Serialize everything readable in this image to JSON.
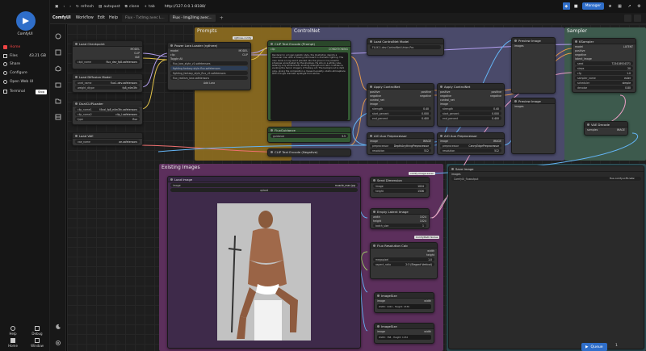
{
  "app": {
    "name": "ComfyUI"
  },
  "sidebar": {
    "items": [
      {
        "label": "Home",
        "value": ""
      },
      {
        "label": "Files",
        "value": "43.21 GB"
      },
      {
        "label": "Share",
        "value": ""
      },
      {
        "label": "Configure",
        "value": ""
      },
      {
        "label": "Open Web UI",
        "value": ""
      },
      {
        "label": "Terminal",
        "value": "Stop"
      }
    ],
    "bottom": [
      {
        "label": "Help"
      },
      {
        "label": "Debug"
      },
      {
        "label": "Home"
      },
      {
        "label": "Window"
      }
    ]
  },
  "topbar": {
    "refresh": "refresh",
    "autopost": "autopost",
    "clone": "clone",
    "newtab": "tab",
    "url": "http://127.0.0.1:8188/",
    "manager": "Manager"
  },
  "menubar": {
    "brand": "ComfyUI",
    "menus": [
      "Workflow",
      "Edit",
      "Help"
    ],
    "tabs": [
      "Flux - TxtImg avec L...",
      "Flux - Img2Img avec..."
    ]
  },
  "groups": {
    "prompts": "Prompts",
    "controlnet": "ControlNet",
    "sampler": "Sampler",
    "existing": "Existing Images"
  },
  "nodes": {
    "checkpoint": {
      "title": "Load Checkpoint",
      "outs": [
        "MODEL",
        "CLIP",
        "VAE"
      ],
      "ckpt_label": "ckpt_name",
      "ckpt_value": "flux_dev_fp8.safetensors"
    },
    "diffusion": {
      "title": "Load Diffusion Model",
      "unet_label": "unet_name",
      "unet_value": "flux1-dev.safetensors",
      "dtype_label": "weight_dtype",
      "dtype_value": "fp8_e4m3fn"
    },
    "dualclip": {
      "title": "DualCLIPLoader",
      "clip1_label": "clip_name1",
      "clip1_value": "t5xxl_fp8_e4m3fn.safetensors",
      "clip2_label": "clip_name2",
      "clip2_value": "clip_l.safetensors",
      "type_label": "type",
      "type_value": "flux"
    },
    "vae": {
      "title": "Load VAE",
      "vae_label": "vae_name",
      "vae_value": "ae.safetensors"
    },
    "lora": {
      "title": "Power Lora Loader (rgthree)",
      "badge": "rgthree-comfy",
      "toggle": "Toggle All",
      "lora1": "flux_lora_style_v1.safetensors",
      "lora2": "fighting-fantasy-style-flux.safetensors",
      "lora3": "fighting_fantasy_style_flux_v2.safetensors",
      "lora4": "flux_realism_lora.safetensors",
      "add": "Add Lora"
    },
    "clip_text": {
      "title": "CLIP Text Encode (Prompt)",
      "text": "Rendered in a hyper-realistic style, the illustration depicts a muscular man with a flowing dark beard in dramatic lighting. The man holds a long sword planted into the ground, his powerful physique accentuated by the shadows. He sits on a white cube, wearing only white briefs, exuding strength and calm confidence, evoking the heroic imagery of fantasy art. The background is dark gray, giving the composition a museum-quality, studio atmosphere with a single dramatic spotlight from above."
    },
    "flux_guidance": {
      "title": "FluxGuidance",
      "label": "guidance",
      "value": "3.5"
    },
    "clip_neg": {
      "title": "CLIP Text Encode (Negative)"
    },
    "controlnet_loader": {
      "title": "Load ControlNet Model",
      "label": "control_net_name",
      "value": "FLUX.1-dev-ControlNet-Union-Pro"
    },
    "apply1": {
      "title": "Apply ControlNet",
      "strength": "0.40",
      "start": "0.000",
      "end": "0.400"
    },
    "apply2": {
      "title": "Apply ControlNet",
      "strength": "0.40",
      "start": "0.000",
      "end": "0.400"
    },
    "aio1": {
      "title": "AIO Aux Preprocessor",
      "label": "preprocessor",
      "value": "DepthAnythingPreprocessor",
      "res": "512"
    },
    "aio2": {
      "title": "AIO Aux Preprocessor",
      "label": "preprocessor",
      "value": "CannyEdgePreprocessor",
      "res": "512"
    },
    "preview1": {
      "title": "Preview Image"
    },
    "preview2": {
      "title": "Preview Image"
    },
    "ksampler": {
      "title": "KSampler",
      "seed": "seed",
      "seed_val": "723418924371",
      "steps": "20",
      "cfg": "1.0",
      "sampler": "euler",
      "scheduler": "simple",
      "denoise": "0.80"
    },
    "vae_decode": {
      "title": "VAE Decode"
    },
    "load_image": {
      "title": "Load Image",
      "label": "image",
      "value": "muscle_man.jpg",
      "upload": "upload"
    },
    "send_dims": {
      "title": "Send Dimension",
      "badge": "comfy-image-saver"
    },
    "empty_latent": {
      "title": "Empty Latent Image",
      "width": "1024",
      "height": "1024",
      "batch": "1"
    },
    "flux_res": {
      "title": "Flux Resolution Calc",
      "megapixel": "1.0",
      "ratio": "2:3 (Elegant Vertical)",
      "badge": "ComfyMath Nodes"
    },
    "image_size": {
      "title": "ImageSize",
      "info": "Width: 1024 , Height: 1536"
    },
    "image_size2": {
      "title": "ImageSize",
      "info": "Width: 768 , Height: 1152"
    },
    "save_image": {
      "title": "Save Image",
      "prefix": "ComfyUI_fluxoutput",
      "badge": "flux-comfyui-ffi-nsfw"
    }
  },
  "footer": {
    "queue": "Queue",
    "queue_count": "1"
  }
}
